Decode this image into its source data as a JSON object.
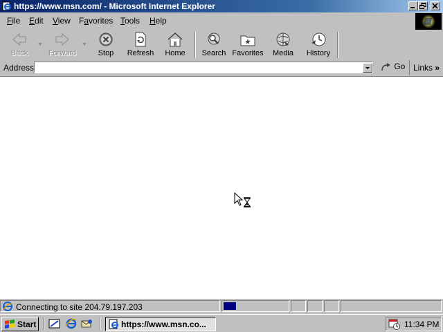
{
  "window": {
    "title": "https://www.msn.com/ - Microsoft Internet Explorer",
    "icon": "ie-page-icon",
    "controls": [
      "minimize-icon",
      "restore-icon",
      "close-icon"
    ]
  },
  "menu": {
    "items": [
      {
        "hotkey": "F",
        "rest": "ile"
      },
      {
        "hotkey": "E",
        "rest": "dit"
      },
      {
        "hotkey": "V",
        "rest": "iew"
      },
      {
        "hotkey": "",
        "pre": "F",
        "hot2": "a",
        "rest": "vorites"
      },
      {
        "hotkey": "T",
        "rest": "ools"
      },
      {
        "hotkey": "H",
        "rest": "elp"
      }
    ]
  },
  "toolbar": {
    "back": {
      "label": "Back",
      "enabled": false,
      "icon": "back-arrow-icon"
    },
    "forward": {
      "label": "Forward",
      "enabled": false,
      "icon": "forward-arrow-icon"
    },
    "stop": {
      "label": "Stop",
      "icon": "stop-icon"
    },
    "refresh": {
      "label": "Refresh",
      "icon": "refresh-icon"
    },
    "home": {
      "label": "Home",
      "icon": "home-icon"
    },
    "search": {
      "label": "Search",
      "icon": "search-icon"
    },
    "favorites": {
      "label": "Favorites",
      "icon": "favorites-folder-icon"
    },
    "media": {
      "label": "Media",
      "icon": "media-icon"
    },
    "history": {
      "label": "History",
      "icon": "history-icon"
    }
  },
  "address": {
    "label": "Address",
    "value": "",
    "go_label": "Go",
    "links_label": "Links"
  },
  "status": {
    "text": "Connecting to site 204.79.197.203",
    "progress": 0.2
  },
  "taskbar": {
    "start_label": "Start",
    "quick_launch": [
      "show-desktop-icon",
      "ie-icon",
      "outlook-express-icon"
    ],
    "task_label": "https://www.msn.co...",
    "clock": "11:34 PM"
  },
  "colors": {
    "titlebar_start": "#0a246a",
    "titlebar_end": "#a6caf0",
    "face": "#c0c0c0",
    "progress": "#000080"
  },
  "cursor": "busy-arrow-hourglass"
}
